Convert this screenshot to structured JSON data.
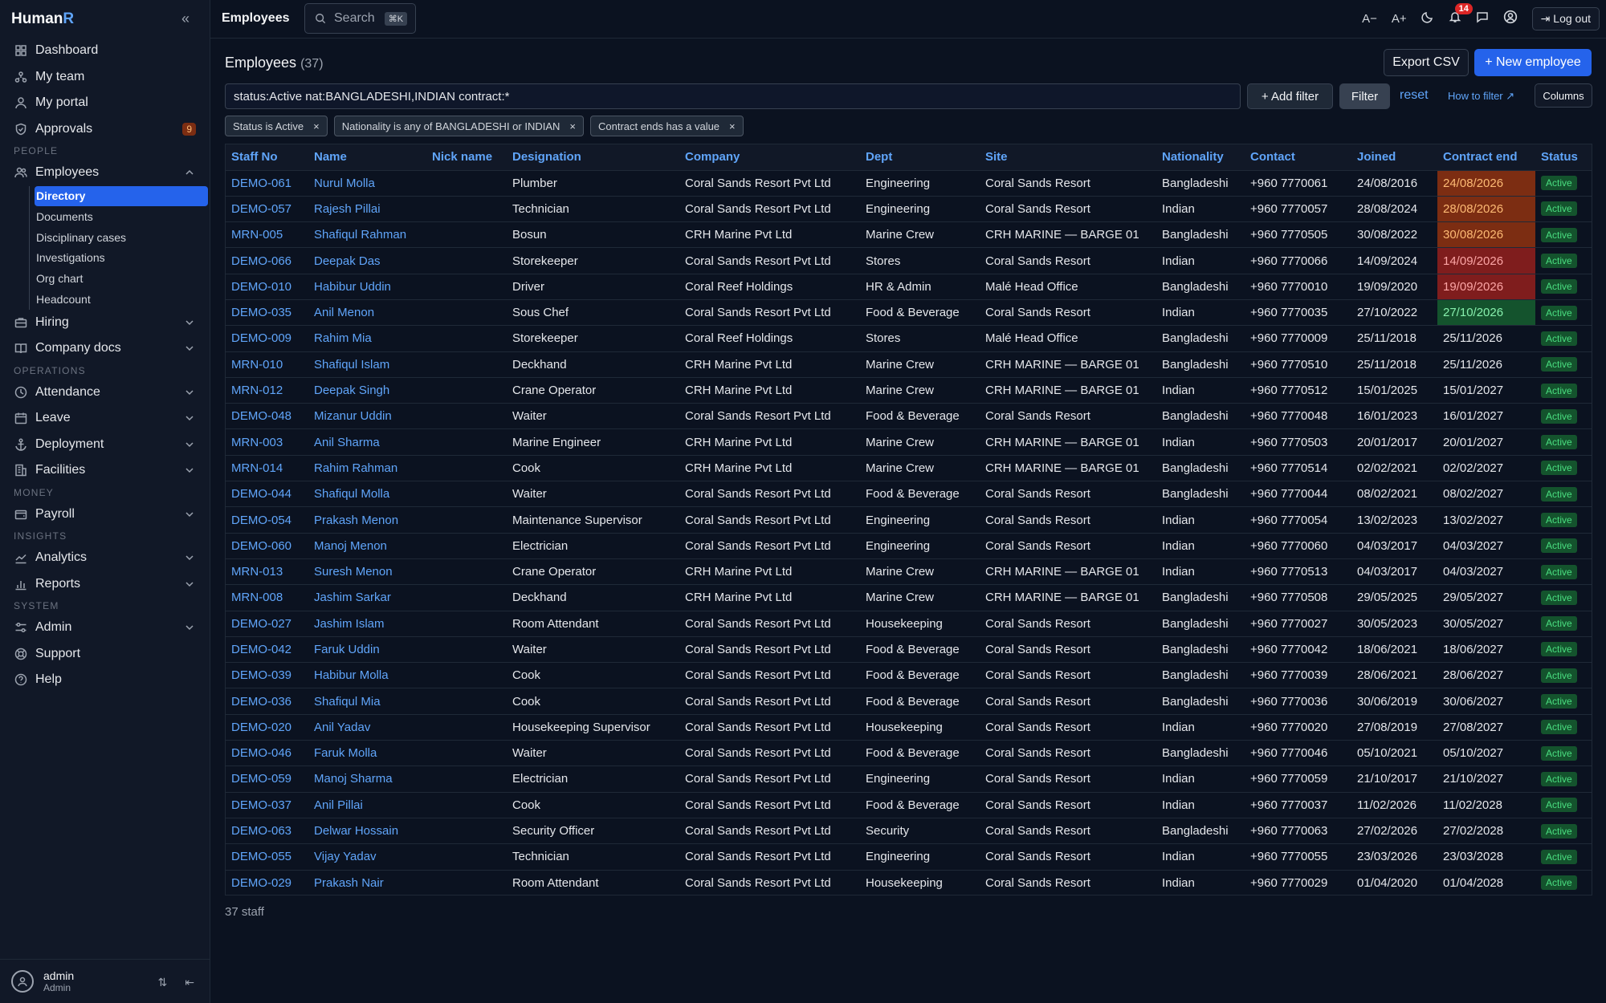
{
  "app": {
    "brand_main": "Human",
    "brand_accent": "R"
  },
  "topbar": {
    "page": "Employees",
    "search_label": "Search",
    "search_kbd": "⌘K",
    "font_smaller": "A−",
    "font_larger": "A+",
    "notif_count": "14",
    "logout_label": "Log out"
  },
  "sidebar": {
    "items": [
      {
        "label": "Dashboard",
        "icon": "grid-icon"
      },
      {
        "label": "My team",
        "icon": "team-icon"
      },
      {
        "label": "My portal",
        "icon": "user-icon"
      },
      {
        "label": "Approvals",
        "icon": "shield-icon",
        "badge": "9"
      }
    ],
    "section_people": "PEOPLE",
    "employees_label": "Employees",
    "subitems": [
      "Directory",
      "Documents",
      "Disciplinary cases",
      "Investigations",
      "Org chart",
      "Headcount"
    ],
    "hiring": "Hiring",
    "company_docs": "Company docs",
    "section_operations": "OPERATIONS",
    "attendance": "Attendance",
    "leave": "Leave",
    "deployment": "Deployment",
    "facilities": "Facilities",
    "section_money": "MONEY",
    "payroll": "Payroll",
    "section_insights": "INSIGHTS",
    "analytics": "Analytics",
    "reports": "Reports",
    "section_system": "SYSTEM",
    "admin": "Admin",
    "support": "Support",
    "help": "Help",
    "user_name": "admin",
    "user_role": "Admin"
  },
  "main": {
    "title": "Employees",
    "count": "(37)",
    "export_label": "Export CSV",
    "new_label": "+ New employee",
    "query": "status:Active nat:BANGLADESHI,INDIAN contract:*",
    "add_filter": "+ Add filter",
    "filter": "Filter",
    "reset": "reset",
    "how_to_filter": "How to filter ↗",
    "columns": "Columns",
    "chips": [
      "Status is Active",
      "Nationality is any of BANGLADESHI or INDIAN",
      "Contract ends has a value"
    ],
    "footer": "37 staff"
  },
  "table": {
    "headers": [
      "Staff No",
      "Name",
      "Nick name",
      "Designation",
      "Company",
      "Dept",
      "Site",
      "Nationality",
      "Contact",
      "Joined",
      "Contract end",
      "Status"
    ],
    "rows": [
      [
        "DEMO-061",
        "Nurul Molla",
        "",
        "Plumber",
        "Coral Sands Resort Pvt Ltd",
        "Engineering",
        "Coral Sands Resort",
        "Bangladeshi",
        "+960 7770061",
        "24/08/2016",
        "24/08/2026",
        "Active",
        "orange"
      ],
      [
        "DEMO-057",
        "Rajesh Pillai",
        "",
        "Technician",
        "Coral Sands Resort Pvt Ltd",
        "Engineering",
        "Coral Sands Resort",
        "Indian",
        "+960 7770057",
        "28/08/2024",
        "28/08/2026",
        "Active",
        "orange"
      ],
      [
        "MRN-005",
        "Shafiqul Rahman",
        "",
        "Bosun",
        "CRH Marine Pvt Ltd",
        "Marine Crew",
        "CRH MARINE — BARGE 01",
        "Bangladeshi",
        "+960 7770505",
        "30/08/2022",
        "30/08/2026",
        "Active",
        "orange"
      ],
      [
        "DEMO-066",
        "Deepak Das",
        "",
        "Storekeeper",
        "Coral Sands Resort Pvt Ltd",
        "Stores",
        "Coral Sands Resort",
        "Indian",
        "+960 7770066",
        "14/09/2024",
        "14/09/2026",
        "Active",
        "red"
      ],
      [
        "DEMO-010",
        "Habibur Uddin",
        "",
        "Driver",
        "Coral Reef Holdings",
        "HR & Admin",
        "Malé Head Office",
        "Bangladeshi",
        "+960 7770010",
        "19/09/2020",
        "19/09/2026",
        "Active",
        "red"
      ],
      [
        "DEMO-035",
        "Anil Menon",
        "",
        "Sous Chef",
        "Coral Sands Resort Pvt Ltd",
        "Food & Beverage",
        "Coral Sands Resort",
        "Indian",
        "+960 7770035",
        "27/10/2022",
        "27/10/2026",
        "Active",
        "green"
      ],
      [
        "DEMO-009",
        "Rahim Mia",
        "",
        "Storekeeper",
        "Coral Reef Holdings",
        "Stores",
        "Malé Head Office",
        "Bangladeshi",
        "+960 7770009",
        "25/11/2018",
        "25/11/2026",
        "Active",
        ""
      ],
      [
        "MRN-010",
        "Shafiqul Islam",
        "",
        "Deckhand",
        "CRH Marine Pvt Ltd",
        "Marine Crew",
        "CRH MARINE — BARGE 01",
        "Bangladeshi",
        "+960 7770510",
        "25/11/2018",
        "25/11/2026",
        "Active",
        ""
      ],
      [
        "MRN-012",
        "Deepak Singh",
        "",
        "Crane Operator",
        "CRH Marine Pvt Ltd",
        "Marine Crew",
        "CRH MARINE — BARGE 01",
        "Indian",
        "+960 7770512",
        "15/01/2025",
        "15/01/2027",
        "Active",
        ""
      ],
      [
        "DEMO-048",
        "Mizanur Uddin",
        "",
        "Waiter",
        "Coral Sands Resort Pvt Ltd",
        "Food & Beverage",
        "Coral Sands Resort",
        "Bangladeshi",
        "+960 7770048",
        "16/01/2023",
        "16/01/2027",
        "Active",
        ""
      ],
      [
        "MRN-003",
        "Anil Sharma",
        "",
        "Marine Engineer",
        "CRH Marine Pvt Ltd",
        "Marine Crew",
        "CRH MARINE — BARGE 01",
        "Indian",
        "+960 7770503",
        "20/01/2017",
        "20/01/2027",
        "Active",
        ""
      ],
      [
        "MRN-014",
        "Rahim Rahman",
        "",
        "Cook",
        "CRH Marine Pvt Ltd",
        "Marine Crew",
        "CRH MARINE — BARGE 01",
        "Bangladeshi",
        "+960 7770514",
        "02/02/2021",
        "02/02/2027",
        "Active",
        ""
      ],
      [
        "DEMO-044",
        "Shafiqul Molla",
        "",
        "Waiter",
        "Coral Sands Resort Pvt Ltd",
        "Food & Beverage",
        "Coral Sands Resort",
        "Bangladeshi",
        "+960 7770044",
        "08/02/2021",
        "08/02/2027",
        "Active",
        ""
      ],
      [
        "DEMO-054",
        "Prakash Menon",
        "",
        "Maintenance Supervisor",
        "Coral Sands Resort Pvt Ltd",
        "Engineering",
        "Coral Sands Resort",
        "Indian",
        "+960 7770054",
        "13/02/2023",
        "13/02/2027",
        "Active",
        ""
      ],
      [
        "DEMO-060",
        "Manoj Menon",
        "",
        "Electrician",
        "Coral Sands Resort Pvt Ltd",
        "Engineering",
        "Coral Sands Resort",
        "Indian",
        "+960 7770060",
        "04/03/2017",
        "04/03/2027",
        "Active",
        ""
      ],
      [
        "MRN-013",
        "Suresh Menon",
        "",
        "Crane Operator",
        "CRH Marine Pvt Ltd",
        "Marine Crew",
        "CRH MARINE — BARGE 01",
        "Indian",
        "+960 7770513",
        "04/03/2017",
        "04/03/2027",
        "Active",
        ""
      ],
      [
        "MRN-008",
        "Jashim Sarkar",
        "",
        "Deckhand",
        "CRH Marine Pvt Ltd",
        "Marine Crew",
        "CRH MARINE — BARGE 01",
        "Bangladeshi",
        "+960 7770508",
        "29/05/2025",
        "29/05/2027",
        "Active",
        ""
      ],
      [
        "DEMO-027",
        "Jashim Islam",
        "",
        "Room Attendant",
        "Coral Sands Resort Pvt Ltd",
        "Housekeeping",
        "Coral Sands Resort",
        "Bangladeshi",
        "+960 7770027",
        "30/05/2023",
        "30/05/2027",
        "Active",
        ""
      ],
      [
        "DEMO-042",
        "Faruk Uddin",
        "",
        "Waiter",
        "Coral Sands Resort Pvt Ltd",
        "Food & Beverage",
        "Coral Sands Resort",
        "Bangladeshi",
        "+960 7770042",
        "18/06/2021",
        "18/06/2027",
        "Active",
        ""
      ],
      [
        "DEMO-039",
        "Habibur Molla",
        "",
        "Cook",
        "Coral Sands Resort Pvt Ltd",
        "Food & Beverage",
        "Coral Sands Resort",
        "Bangladeshi",
        "+960 7770039",
        "28/06/2021",
        "28/06/2027",
        "Active",
        ""
      ],
      [
        "DEMO-036",
        "Shafiqul Mia",
        "",
        "Cook",
        "Coral Sands Resort Pvt Ltd",
        "Food & Beverage",
        "Coral Sands Resort",
        "Bangladeshi",
        "+960 7770036",
        "30/06/2019",
        "30/06/2027",
        "Active",
        ""
      ],
      [
        "DEMO-020",
        "Anil Yadav",
        "",
        "Housekeeping Supervisor",
        "Coral Sands Resort Pvt Ltd",
        "Housekeeping",
        "Coral Sands Resort",
        "Indian",
        "+960 7770020",
        "27/08/2019",
        "27/08/2027",
        "Active",
        ""
      ],
      [
        "DEMO-046",
        "Faruk Molla",
        "",
        "Waiter",
        "Coral Sands Resort Pvt Ltd",
        "Food & Beverage",
        "Coral Sands Resort",
        "Bangladeshi",
        "+960 7770046",
        "05/10/2021",
        "05/10/2027",
        "Active",
        ""
      ],
      [
        "DEMO-059",
        "Manoj Sharma",
        "",
        "Electrician",
        "Coral Sands Resort Pvt Ltd",
        "Engineering",
        "Coral Sands Resort",
        "Indian",
        "+960 7770059",
        "21/10/2017",
        "21/10/2027",
        "Active",
        ""
      ],
      [
        "DEMO-037",
        "Anil Pillai",
        "",
        "Cook",
        "Coral Sands Resort Pvt Ltd",
        "Food & Beverage",
        "Coral Sands Resort",
        "Indian",
        "+960 7770037",
        "11/02/2026",
        "11/02/2028",
        "Active",
        ""
      ],
      [
        "DEMO-063",
        "Delwar Hossain",
        "",
        "Security Officer",
        "Coral Sands Resort Pvt Ltd",
        "Security",
        "Coral Sands Resort",
        "Bangladeshi",
        "+960 7770063",
        "27/02/2026",
        "27/02/2028",
        "Active",
        ""
      ],
      [
        "DEMO-055",
        "Vijay Yadav",
        "",
        "Technician",
        "Coral Sands Resort Pvt Ltd",
        "Engineering",
        "Coral Sands Resort",
        "Indian",
        "+960 7770055",
        "23/03/2026",
        "23/03/2028",
        "Active",
        ""
      ],
      [
        "DEMO-029",
        "Prakash Nair",
        "",
        "Room Attendant",
        "Coral Sands Resort Pvt Ltd",
        "Housekeeping",
        "Coral Sands Resort",
        "Indian",
        "+960 7770029",
        "01/04/2020",
        "01/04/2028",
        "Active",
        ""
      ]
    ]
  },
  "colors": {
    "accent": "#2563eb",
    "link": "#60a5fa",
    "bg": "#0b1220",
    "sidebar": "#111827"
  }
}
